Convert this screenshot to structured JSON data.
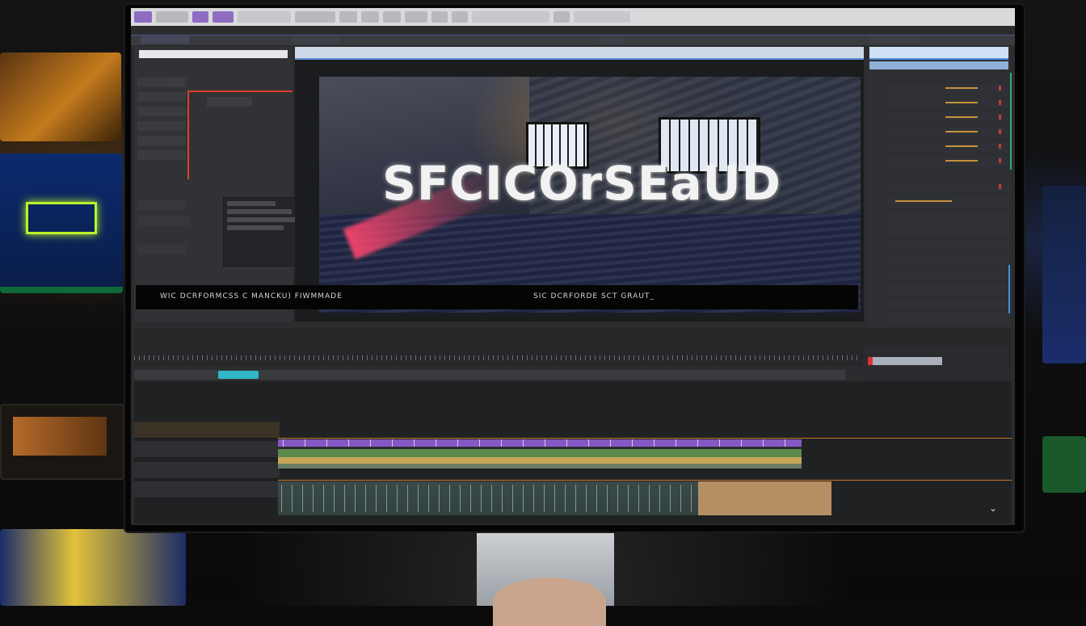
{
  "video_overlay": {
    "title": "SFCICOrSEaUD",
    "subtitle_left": "WIC DCRFORMCSS C MANCKU) FIWMMADE",
    "subtitle_right": "SIC DCRFORDE SCT GRAUT_"
  },
  "colors": {
    "accent_blue": "#5d8ed8",
    "clip_purple": "#8458c2",
    "clip_green": "#5c8a4a",
    "clip_tan": "#c7a458",
    "audio_tan": "#b58f62",
    "marker_red": "#d8412e",
    "tool_cyan": "#2fb7c9"
  },
  "icons": {
    "timeline_expand": "chevron-down-icon",
    "program_expand": "chevron-down-icon"
  }
}
